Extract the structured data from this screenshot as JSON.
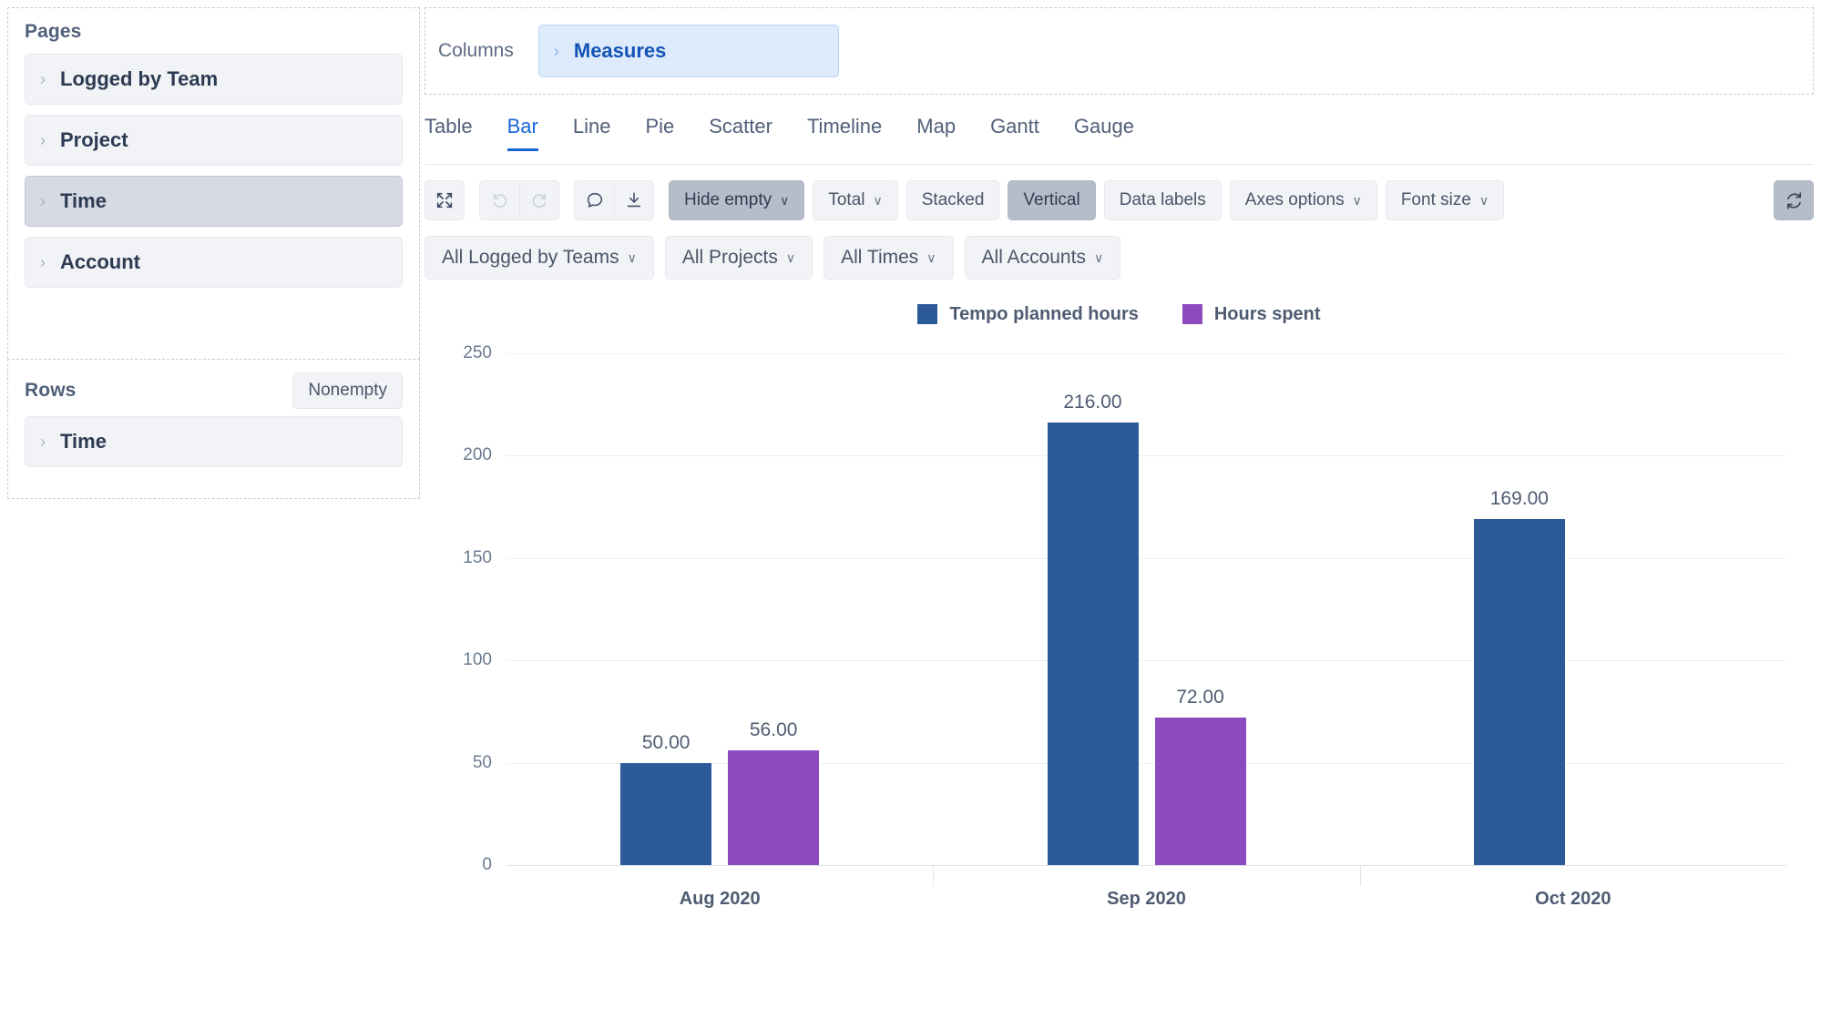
{
  "shelves": {
    "pages": {
      "title": "Pages",
      "items": [
        {
          "label": "Logged by Team",
          "selected": false
        },
        {
          "label": "Project",
          "selected": false
        },
        {
          "label": "Time",
          "selected": true
        },
        {
          "label": "Account",
          "selected": false
        }
      ]
    },
    "rows": {
      "title": "Rows",
      "nonempty_label": "Nonempty",
      "items": [
        {
          "label": "Time",
          "selected": false
        }
      ]
    },
    "columns": {
      "title": "Columns",
      "items": [
        {
          "label": "Measures",
          "selected": false
        }
      ]
    }
  },
  "tabs": [
    {
      "label": "Table",
      "active": false
    },
    {
      "label": "Bar",
      "active": true
    },
    {
      "label": "Line",
      "active": false
    },
    {
      "label": "Pie",
      "active": false
    },
    {
      "label": "Scatter",
      "active": false
    },
    {
      "label": "Timeline",
      "active": false
    },
    {
      "label": "Map",
      "active": false
    },
    {
      "label": "Gantt",
      "active": false
    },
    {
      "label": "Gauge",
      "active": false
    }
  ],
  "toolbar": {
    "fullscreen_icon": "expand-arrows-icon",
    "undo_icon": "undo-icon",
    "redo_icon": "redo-icon",
    "comment_icon": "comment-bubble-icon",
    "download_icon": "download-icon",
    "hide_empty_label": "Hide empty",
    "total_label": "Total",
    "stacked_label": "Stacked",
    "vertical_label": "Vertical",
    "data_labels_label": "Data labels",
    "axes_options_label": "Axes options",
    "font_size_label": "Font size",
    "refresh_icon": "refresh-icon",
    "caret": "∨"
  },
  "filters": [
    {
      "label": "All Logged by Teams"
    },
    {
      "label": "All Projects"
    },
    {
      "label": "All Times"
    },
    {
      "label": "All Accounts"
    }
  ],
  "colors": {
    "series_blue": "#2d5b99",
    "series_purple": "#8b4bbe",
    "accent": "#1665d8",
    "text": "#4e5b72"
  },
  "chart_data": {
    "type": "bar",
    "title": "",
    "xlabel": "",
    "ylabel": "",
    "ylim": [
      0,
      250
    ],
    "yticks": [
      0,
      50,
      100,
      150,
      200,
      250
    ],
    "ytick_labels": [
      "0",
      "50",
      "100",
      "150",
      "200",
      "250"
    ],
    "grid": true,
    "legend_position": "top-center",
    "orientation": "vertical",
    "stacked": false,
    "categories": [
      "Aug 2020",
      "Sep 2020",
      "Oct 2020"
    ],
    "series": [
      {
        "name": "Tempo planned hours",
        "color": "#2d5b99",
        "values": [
          50,
          216,
          169
        ],
        "labels": [
          "50.00",
          "216.00",
          "169.00"
        ]
      },
      {
        "name": "Hours spent",
        "color": "#8b4bbe",
        "values": [
          56,
          72,
          null
        ],
        "labels": [
          "56.00",
          "72.00",
          ""
        ]
      }
    ]
  }
}
